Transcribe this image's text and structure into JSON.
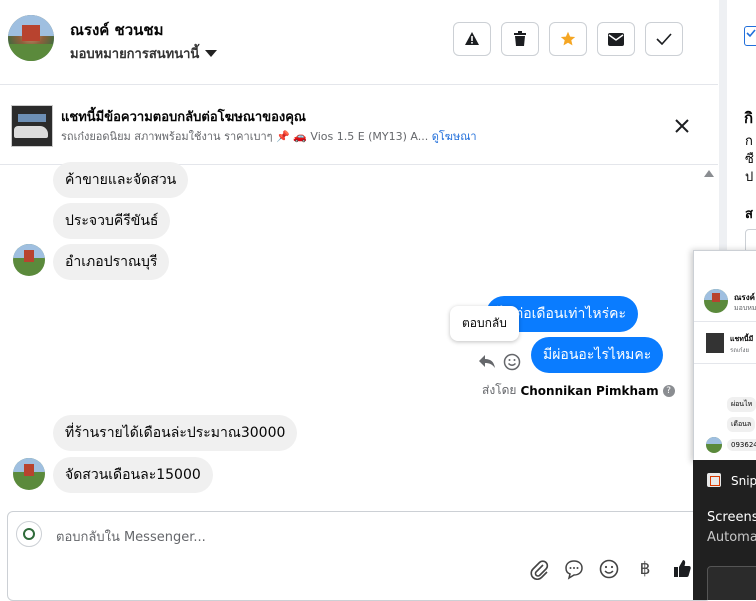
{
  "header": {
    "contact_name": "ณรงค์ ชวนชม",
    "assign_label": "มอบหมายการสนทนานี้",
    "actions": [
      {
        "name": "report-button",
        "icon": "warning-icon"
      },
      {
        "name": "delete-button",
        "icon": "trash-icon"
      },
      {
        "name": "star-button",
        "icon": "star-icon",
        "color": "#f5a623"
      },
      {
        "name": "mark-unread-button",
        "icon": "envelope-icon"
      },
      {
        "name": "mark-done-button",
        "icon": "check-icon"
      }
    ]
  },
  "ad_banner": {
    "title": "แชทนี้มีข้อความตอบกลับต่อโฆษณาของคุณ",
    "subtitle": "รถเก๋งยอดนิยม สภาพพร้อมใช้งาน ราคาเบาๆ 📌 🚗 Vios 1.5 E (MY13) A...",
    "link": "ดูโฆษณา"
  },
  "messages": {
    "in_1": "ค้าขายและจัดสวน",
    "in_2": "ประจวบคีรีขันธ์",
    "in_3": "อำเภอปราณบุรี",
    "out_1": "ได้ต่อเดือนเท่าไหร่คะ",
    "out_2": "มีผ่อนอะไรไหมคะ",
    "tooltip": "ตอบกลับ",
    "sent_by_prefix": "ส่งโดย",
    "sent_by_name": "Chonnikan Pimkham",
    "help": "?",
    "in_4": "ที่ร้านรายได้เดือนล่ะประมาณ30000",
    "in_5": "จัดสวนเดือนละ15000"
  },
  "composer": {
    "placeholder": "ตอบกลับใน Messenger...",
    "currency": "฿"
  },
  "right_panel": {
    "heading_fragment": "กิ",
    "lines": [
      "ก",
      "ซื",
      "ป"
    ],
    "label_fragment": "ส",
    "popup_name": "ณรงค์",
    "popup_sub": "มอบหม",
    "popup_ad": "แชทนี้มี",
    "popup_ad_sub": "รถเก๋งย",
    "popup_msgs": [
      "ผ่อนไห",
      "เดือนล",
      "093624"
    ],
    "snip_title": "Snip",
    "snip_line1": "Screens",
    "snip_line2": "Automa"
  },
  "colors": {
    "outgoing_bubble": "#0a7cff",
    "incoming_bubble": "#f0f0f0",
    "link": "#216fdb",
    "star": "#f5a623"
  }
}
